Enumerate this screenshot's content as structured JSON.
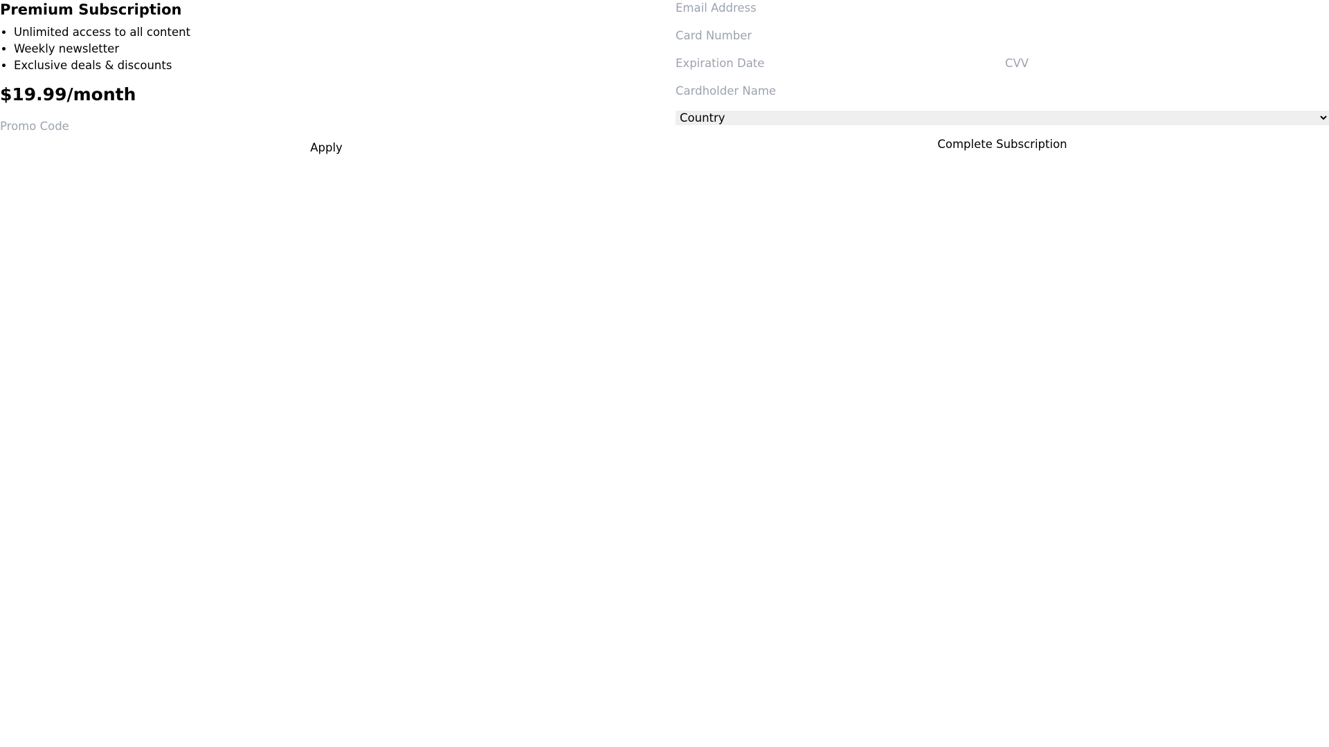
{
  "plan": {
    "title": "Premium Subscription",
    "features": [
      "Unlimited access to all content",
      "Weekly newsletter",
      "Exclusive deals & discounts"
    ],
    "price": "$19.99/month",
    "promo": {
      "placeholder": "Promo Code",
      "value": "",
      "apply_label": "Apply"
    }
  },
  "payment_form": {
    "email": {
      "placeholder": "Email Address",
      "value": ""
    },
    "card_number": {
      "placeholder": "Card Number",
      "value": ""
    },
    "expiration": {
      "placeholder": "Expiration Date",
      "value": ""
    },
    "cvv": {
      "placeholder": "CVV",
      "value": ""
    },
    "cardholder": {
      "placeholder": "Cardholder Name",
      "value": ""
    },
    "country": {
      "selected": "Country"
    },
    "submit_label": "Complete Subscription"
  },
  "colors": {
    "placeholder": "#9ca3af",
    "select_background": "#efefef"
  }
}
